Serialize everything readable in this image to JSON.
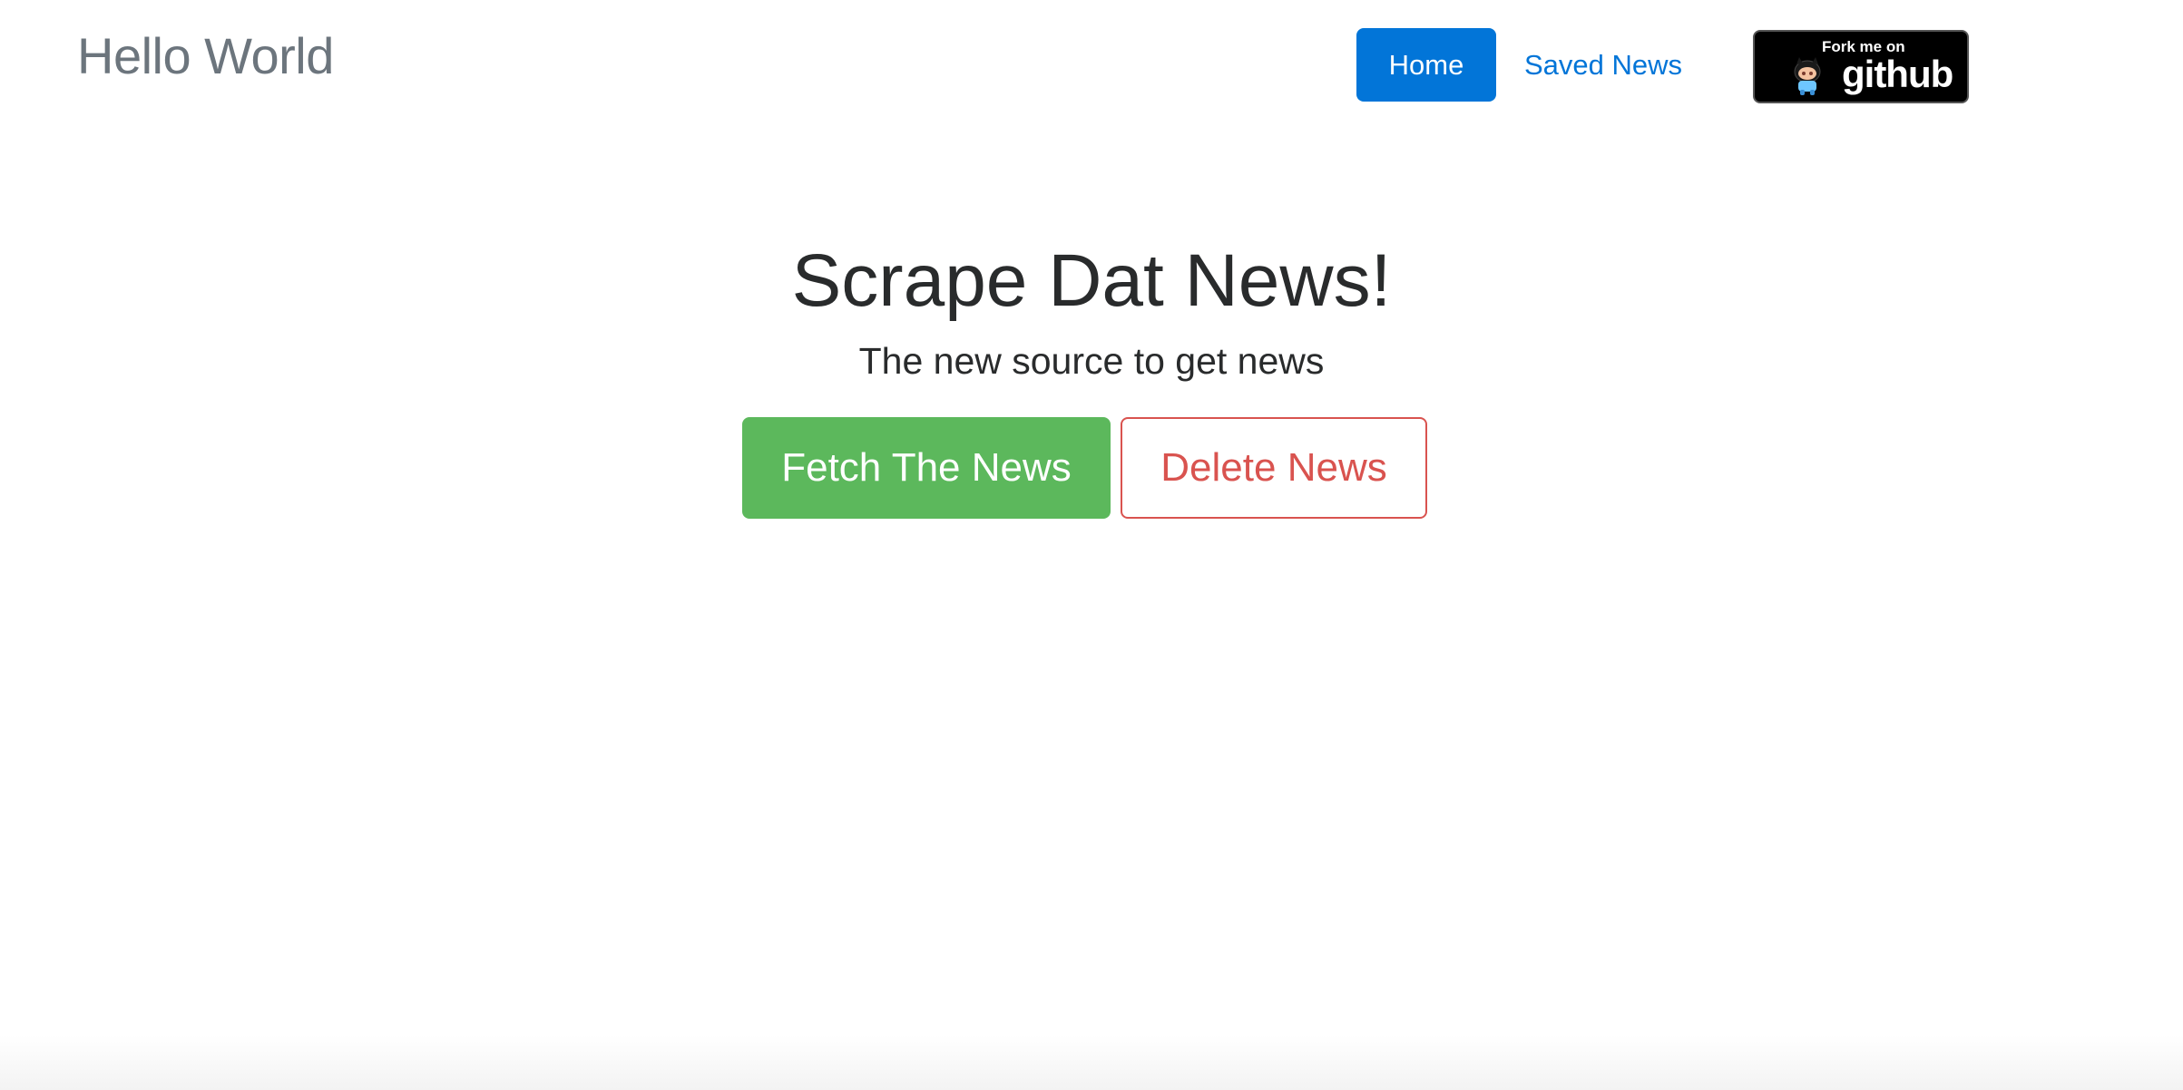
{
  "navbar": {
    "brand": "Hello World",
    "links": [
      {
        "label": "Home",
        "active": true
      },
      {
        "label": "Saved News",
        "active": false
      }
    ]
  },
  "github_badge": {
    "line1": "Fork me on",
    "line2": "github",
    "icon": "octocat-icon"
  },
  "hero": {
    "title": "Scrape Dat News!",
    "subtitle": "The new source to get news",
    "fetch_button": "Fetch The News",
    "delete_button": "Delete News"
  },
  "colors": {
    "primary": "#0275d8",
    "success": "#5cb85c",
    "danger": "#d9534f",
    "brand_text": "#6c757d",
    "heading_text": "#292b2c"
  }
}
